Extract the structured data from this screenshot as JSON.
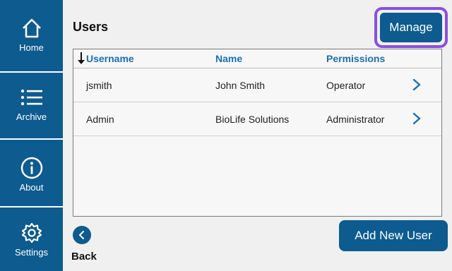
{
  "sidebar": {
    "items": [
      {
        "label": "Home",
        "icon": "home-icon"
      },
      {
        "label": "Archive",
        "icon": "list-icon"
      },
      {
        "label": "About",
        "icon": "info-icon"
      },
      {
        "label": "Settings",
        "icon": "gear-icon"
      }
    ]
  },
  "main": {
    "title": "Users",
    "manage_label": "Manage",
    "table": {
      "columns": [
        "Username",
        "Name",
        "Permissions"
      ],
      "sort_icon": "sort-down-arrow-icon",
      "rows": [
        {
          "username": "jsmith",
          "name": "John Smith",
          "permissions": "Operator"
        },
        {
          "username": "Admin",
          "name": "BioLife Solutions",
          "permissions": "Administrator"
        }
      ]
    },
    "back_label": "Back",
    "add_user_label": "Add New User"
  },
  "colors": {
    "primary": "#0d5b8f",
    "header_text": "#1a6fb0",
    "highlight": "#8a4fe0",
    "background": "#f0f0f0"
  }
}
